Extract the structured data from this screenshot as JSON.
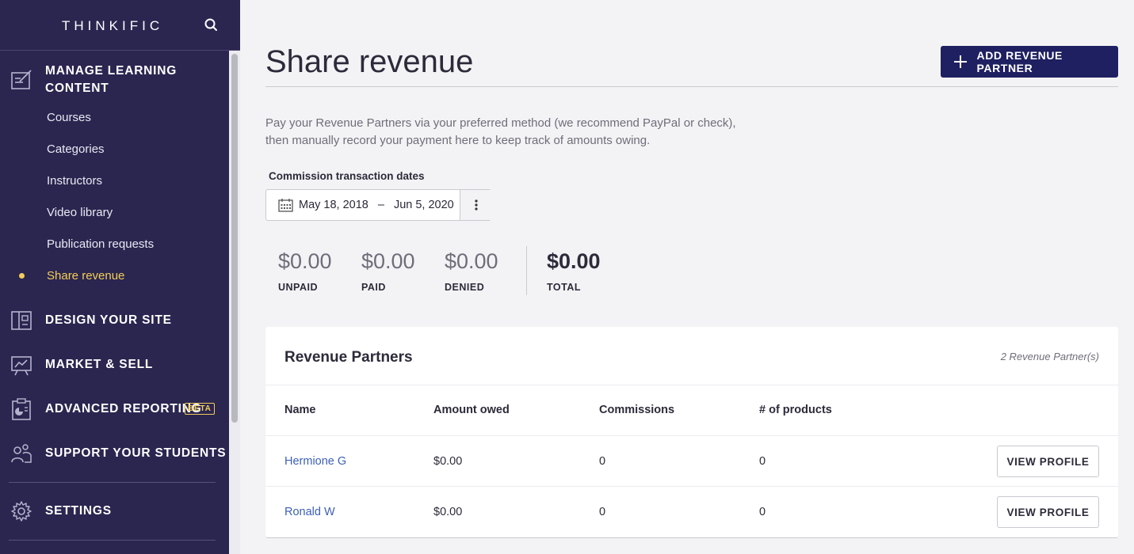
{
  "sidebar": {
    "logo": "THINKIFIC",
    "sections": {
      "manage": {
        "label_line1": "MANAGE LEARNING",
        "label_line2": "CONTENT"
      },
      "design": {
        "label": "DESIGN YOUR SITE"
      },
      "market": {
        "label": "MARKET & SELL"
      },
      "reporting": {
        "label": "ADVANCED REPORTING",
        "badge": "BETA"
      },
      "support": {
        "label": "SUPPORT YOUR STUDENTS"
      },
      "settings": {
        "label": "SETTINGS"
      }
    },
    "sub_items": [
      "Courses",
      "Categories",
      "Instructors",
      "Video library",
      "Publication requests",
      "Share revenue"
    ],
    "active_item": "Share revenue",
    "accent_color": "#f4cd57"
  },
  "header": {
    "title": "Share revenue",
    "add_button": "ADD REVENUE PARTNER"
  },
  "description": {
    "line1": "Pay your Revenue Partners via your preferred method (we recommend PayPal or check),",
    "line2": "then manually record your payment here to keep track of amounts owing."
  },
  "date_filter": {
    "label": "Commission transaction dates",
    "start": "May 18, 2018",
    "separator": "–",
    "end": "Jun 5, 2020"
  },
  "stats": {
    "unpaid": {
      "value": "$0.00",
      "label": "UNPAID"
    },
    "paid": {
      "value": "$0.00",
      "label": "PAID"
    },
    "denied": {
      "value": "$0.00",
      "label": "DENIED"
    },
    "total": {
      "value": "$0.00",
      "label": "TOTAL"
    }
  },
  "partners": {
    "title": "Revenue Partners",
    "count": "2 Revenue Partner(s)",
    "columns": [
      "Name",
      "Amount owed",
      "Commissions",
      "# of products"
    ],
    "rows": [
      {
        "name": "Hermione G",
        "amount": "$0.00",
        "commissions": "0",
        "products": "0",
        "action": "VIEW PROFILE"
      },
      {
        "name": "Ronald W",
        "amount": "$0.00",
        "commissions": "0",
        "products": "0",
        "action": "VIEW PROFILE"
      }
    ]
  },
  "colors": {
    "sidebar_bg": "#2a2650",
    "primary_button": "#1f2061",
    "link": "#3c5fb5"
  }
}
